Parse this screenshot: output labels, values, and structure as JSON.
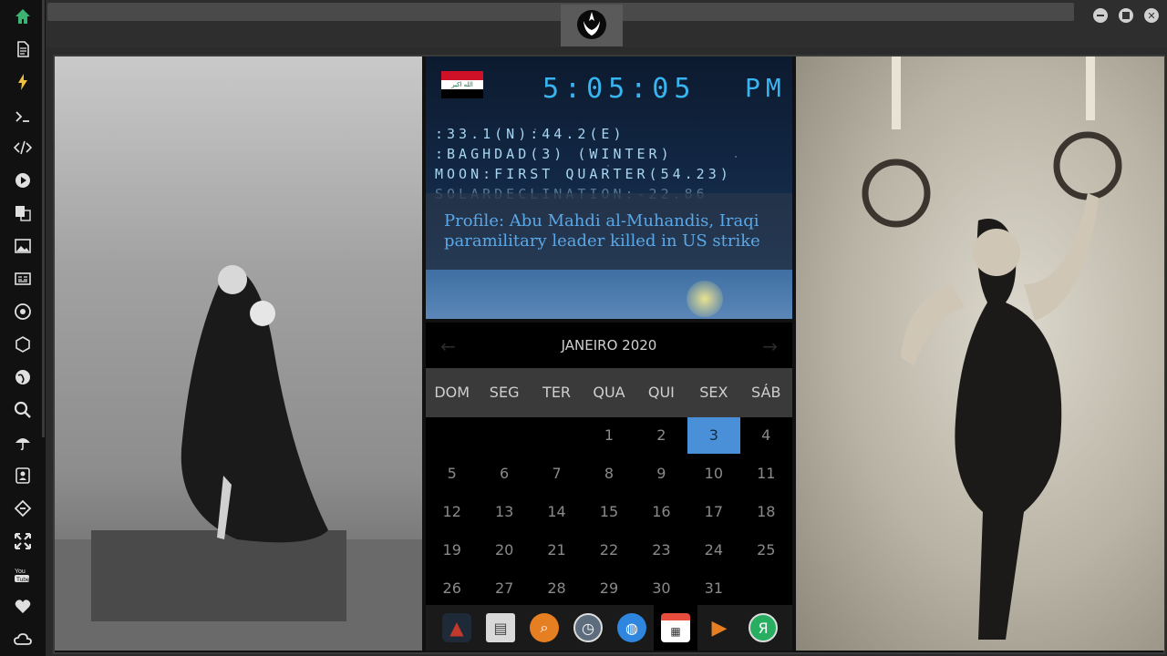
{
  "sidebar": {
    "items": [
      {
        "icon": "home-icon",
        "color": "#3cb371"
      },
      {
        "icon": "document-icon",
        "color": "#e0e0e0"
      },
      {
        "icon": "lightning-icon",
        "color": "#f0c040"
      },
      {
        "icon": "terminal-icon",
        "color": "#e0e0e0"
      },
      {
        "icon": "code-icon",
        "color": "#e0e0e0"
      },
      {
        "icon": "play-icon",
        "color": "#e0e0e0"
      },
      {
        "icon": "translate-icon",
        "color": "#e0e0e0"
      },
      {
        "icon": "image-icon",
        "color": "#e0e0e0"
      },
      {
        "icon": "news-icon",
        "color": "#e0e0e0"
      },
      {
        "icon": "rebel-icon",
        "color": "#e0e0e0"
      },
      {
        "icon": "hexagon-icon",
        "color": "#e0e0e0"
      },
      {
        "icon": "globe-icon",
        "color": "#e0e0e0"
      },
      {
        "icon": "search-icon",
        "color": "#e0e0e0"
      },
      {
        "icon": "umbrella-icon",
        "color": "#e0e0e0"
      },
      {
        "icon": "contacts-icon",
        "color": "#e0e0e0"
      },
      {
        "icon": "link-icon",
        "color": "#e0e0e0"
      },
      {
        "icon": "expand-icon",
        "color": "#e0e0e0"
      },
      {
        "icon": "youtube-icon",
        "color": "#e0e0e0"
      },
      {
        "icon": "heart-icon",
        "color": "#e0e0e0"
      },
      {
        "icon": "cloud-icon",
        "color": "#e0e0e0"
      }
    ]
  },
  "clock": {
    "time": "5:05:05",
    "ampm": "PM",
    "coords": ":33.1(N):44.2(E)",
    "location": ":BAGHDAD(3) (WINTER)",
    "moon": "MOON:FIRST QUARTER(54.23)",
    "solar": "SOLARDECLINATION:-22.86",
    "flag_colors": [
      "#ce1126",
      "#ffffff",
      "#000000"
    ],
    "news_headline": "Profile: Abu Mahdi al-Muhandis, Iraqi paramilitary leader killed in US strike"
  },
  "calendar": {
    "month_title": "JANEIRO 2020",
    "prev_arrow": "←",
    "next_arrow": "→",
    "weekdays": [
      "DOM",
      "SEG",
      "TER",
      "QUA",
      "QUI",
      "SEX",
      "SÁB"
    ],
    "weeks": [
      [
        "",
        "",
        "",
        "1",
        "2",
        "3",
        "4"
      ],
      [
        "5",
        "6",
        "7",
        "8",
        "9",
        "10",
        "11"
      ],
      [
        "12",
        "13",
        "14",
        "15",
        "16",
        "17",
        "18"
      ],
      [
        "19",
        "20",
        "21",
        "22",
        "23",
        "24",
        "25"
      ],
      [
        "26",
        "27",
        "28",
        "29",
        "30",
        "31",
        ""
      ]
    ],
    "today": "3",
    "accent": "#4a90d9"
  },
  "dock": {
    "apps": [
      {
        "icon": "app-launcher-icon",
        "color": "#c0392b",
        "glyph": "▲"
      },
      {
        "icon": "newspaper-icon",
        "color": "#d9d9d9",
        "glyph": "▤"
      },
      {
        "icon": "search-app-icon",
        "color": "#e67e22",
        "glyph": "⌕"
      },
      {
        "icon": "clock-app-icon",
        "color": "#5d6d7e",
        "glyph": "◷"
      },
      {
        "icon": "browser-globe-icon",
        "color": "#2e86de",
        "glyph": "◍"
      },
      {
        "icon": "calendar-app-icon",
        "color": "#e74c3c",
        "glyph": "▦"
      },
      {
        "icon": "forward-arrow-icon",
        "color": "#e67e22",
        "glyph": "▶"
      },
      {
        "icon": "yandex-icon",
        "color": "#27ae60",
        "glyph": "Я"
      }
    ],
    "active": 5
  }
}
